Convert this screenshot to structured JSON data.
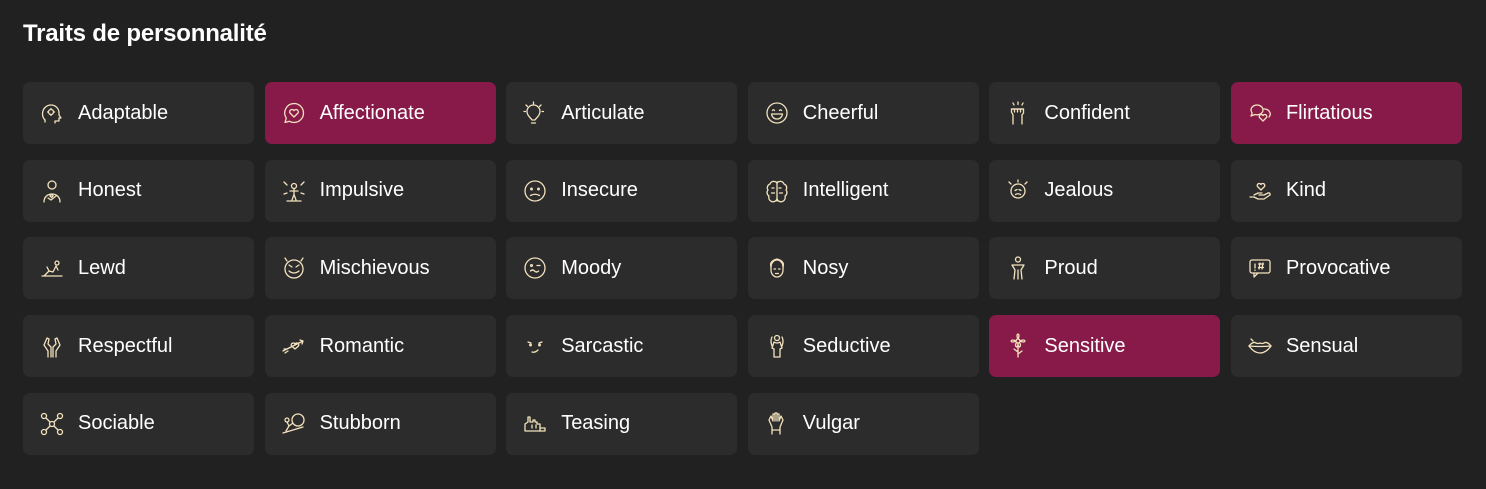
{
  "title": "Traits de personnalité",
  "colors": {
    "background": "#212121",
    "card": "#2c2c2c",
    "selected": "#871a48",
    "icon": "#f3e2bd",
    "text": "#ffffff"
  },
  "traits": [
    {
      "label": "Adaptable",
      "icon": "head-gears-icon",
      "selected": false
    },
    {
      "label": "Affectionate",
      "icon": "heart-bubble-icon",
      "selected": true
    },
    {
      "label": "Articulate",
      "icon": "lightbulb-icon",
      "selected": false
    },
    {
      "label": "Cheerful",
      "icon": "smiling-face-icon",
      "selected": false
    },
    {
      "label": "Confident",
      "icon": "raised-fist-icon",
      "selected": false
    },
    {
      "label": "Flirtatious",
      "icon": "heart-chat-icon",
      "selected": true
    },
    {
      "label": "Honest",
      "icon": "hand-on-heart-icon",
      "selected": false
    },
    {
      "label": "Impulsive",
      "icon": "burst-figure-icon",
      "selected": false
    },
    {
      "label": "Insecure",
      "icon": "worried-face-icon",
      "selected": false
    },
    {
      "label": "Intelligent",
      "icon": "brain-icon",
      "selected": false
    },
    {
      "label": "Jealous",
      "icon": "jealous-face-icon",
      "selected": false
    },
    {
      "label": "Kind",
      "icon": "hand-heart-icon",
      "selected": false
    },
    {
      "label": "Lewd",
      "icon": "reclining-figure-icon",
      "selected": false
    },
    {
      "label": "Mischievous",
      "icon": "devilish-face-icon",
      "selected": false
    },
    {
      "label": "Moody",
      "icon": "moody-face-icon",
      "selected": false
    },
    {
      "label": "Nosy",
      "icon": "peeking-face-icon",
      "selected": false
    },
    {
      "label": "Proud",
      "icon": "standing-figure-icon",
      "selected": false
    },
    {
      "label": "Provocative",
      "icon": "censored-speech-icon",
      "selected": false
    },
    {
      "label": "Respectful",
      "icon": "bowing-hands-icon",
      "selected": false
    },
    {
      "label": "Romantic",
      "icon": "cupid-arrow-icon",
      "selected": false
    },
    {
      "label": "Sarcastic",
      "icon": "smirk-face-icon",
      "selected": false
    },
    {
      "label": "Seductive",
      "icon": "seductive-figure-icon",
      "selected": false
    },
    {
      "label": "Sensitive",
      "icon": "flower-icon",
      "selected": true
    },
    {
      "label": "Sensual",
      "icon": "lips-icon",
      "selected": false
    },
    {
      "label": "Sociable",
      "icon": "network-people-icon",
      "selected": false
    },
    {
      "label": "Stubborn",
      "icon": "pushing-boulder-icon",
      "selected": false
    },
    {
      "label": "Teasing",
      "icon": "pointing-hand-icon",
      "selected": false
    },
    {
      "label": "Vulgar",
      "icon": "gesture-hand-icon",
      "selected": false
    }
  ]
}
